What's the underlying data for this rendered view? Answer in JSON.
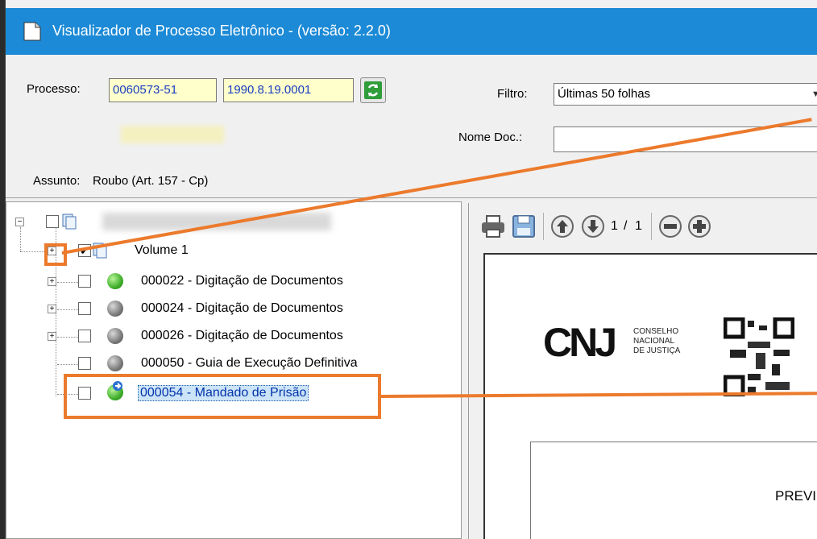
{
  "window": {
    "title": "Visualizador de Processo Eletrônico - (versão: 2.2.0)"
  },
  "header": {
    "processo_label": "Processo:",
    "processo_number": "0060573-51",
    "processo_year": "1990.8.19.0001",
    "filtro_label": "Filtro:",
    "filtro_value": "Últimas 50 folhas",
    "nome_doc_label": "Nome Doc.:",
    "nome_doc_value": "",
    "assunto_label": "Assunto:",
    "assunto_value": "Roubo (Art. 157 - Cp)"
  },
  "tree": {
    "volume_label": "Volume 1",
    "items": [
      {
        "label": "000022 - Digitação de Documentos",
        "status": "green",
        "expandable": true
      },
      {
        "label": "000024 - Digitação de Documentos",
        "status": "gray",
        "expandable": true
      },
      {
        "label": "000026 - Digitação de Documentos",
        "status": "gray",
        "expandable": true
      },
      {
        "label": "000050 - Guia de Execução Definitiva",
        "status": "gray",
        "expandable": false
      },
      {
        "label": "000054 - Mandado de Prisão",
        "status": "green",
        "expandable": false,
        "selected": true
      }
    ]
  },
  "viewer": {
    "page_current": "1",
    "page_sep": "/",
    "page_total": "1",
    "logo_text": "CNJ",
    "logo_sub_1": "CONSELHO",
    "logo_sub_2": "NACIONAL",
    "logo_sub_3": "DE JUSTIÇA",
    "document_text": "PREVI"
  },
  "colors": {
    "titlebar": "#1c8ad6",
    "annotation": "#ec7a2c",
    "field_bg": "#ffffcc"
  }
}
